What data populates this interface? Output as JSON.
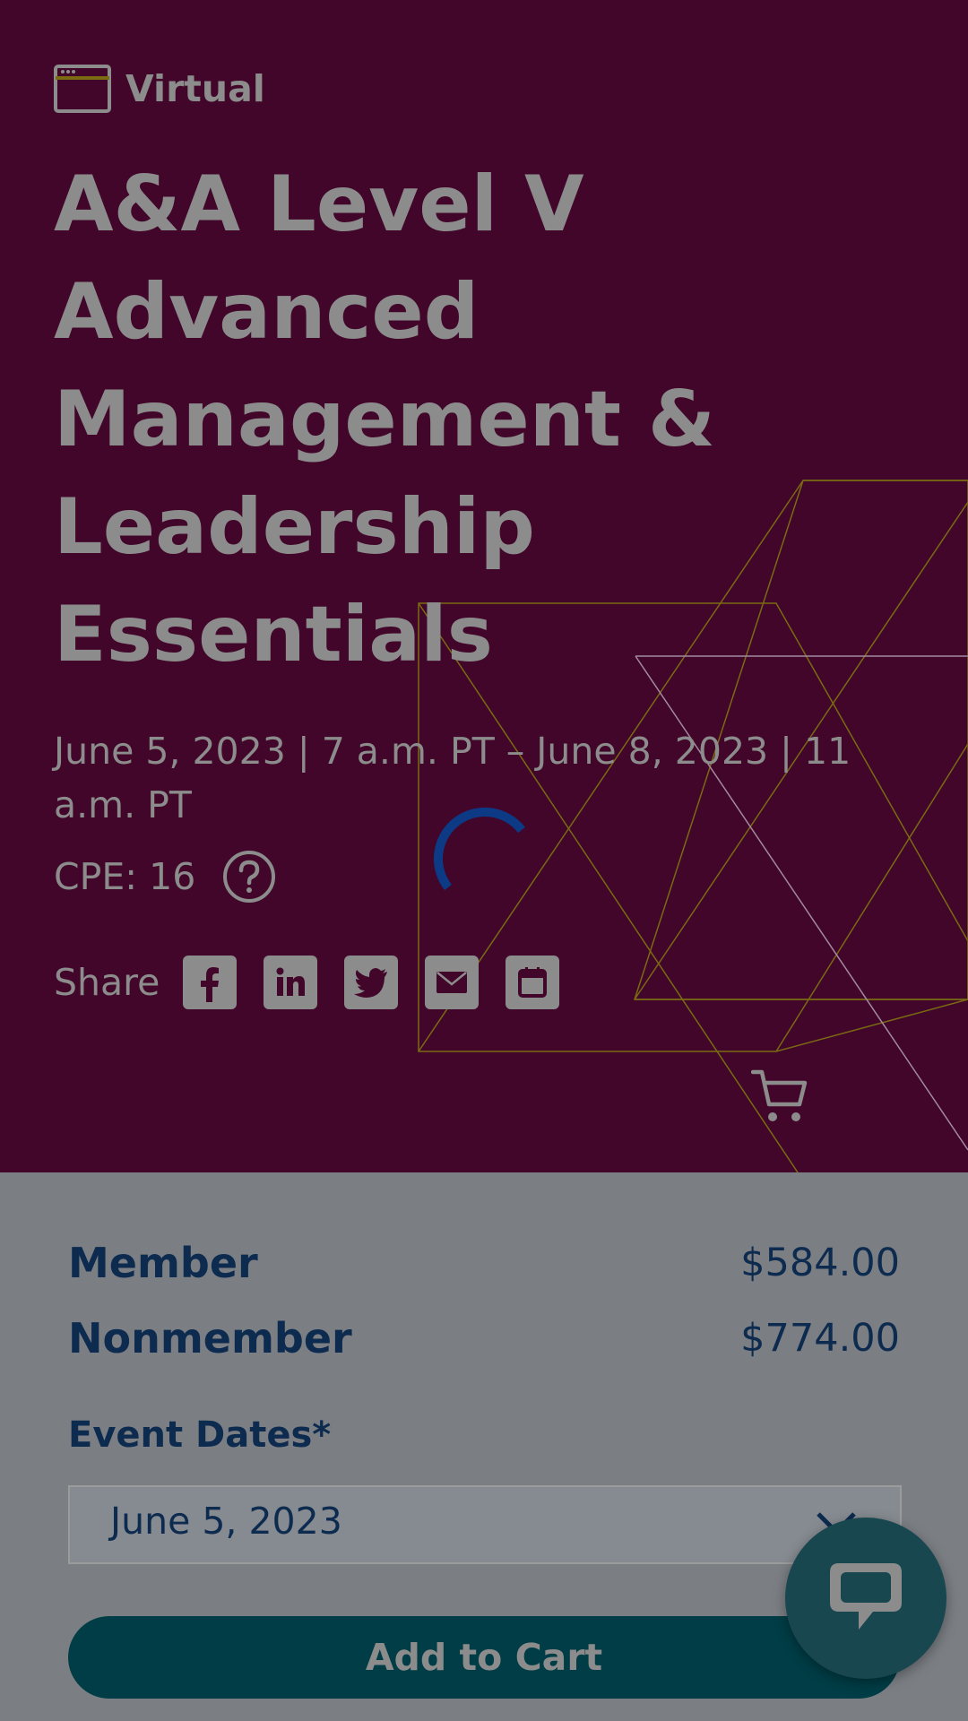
{
  "event": {
    "format": "Virtual",
    "format_icon": "browser-window-icon",
    "title": "A&A Level V Advanced Management & Leadership Essentials",
    "dates": "June 5, 2023 | 7 a.m. PT – June 8, 2023 | 11 a.m. PT",
    "cpe": "CPE: 16"
  },
  "share": {
    "label": "Share",
    "buttons": [
      "facebook-icon",
      "linkedin-icon",
      "twitter-icon",
      "email-icon",
      "calendar-icon"
    ]
  },
  "pricing": {
    "member_label": "Member",
    "member_price": "$584.00",
    "nonmember_label": "Nonmember",
    "nonmember_price": "$774.00"
  },
  "form": {
    "event_dates_label": "Event Dates*",
    "selected_date": "June 5, 2023",
    "add_to_cart_label": "Add to Cart"
  },
  "colors": {
    "hero_bg": "#41062a",
    "accent_teal": "#003d46",
    "text_navy": "#0d2a4f",
    "overlay_gray": "#7b7f84"
  }
}
